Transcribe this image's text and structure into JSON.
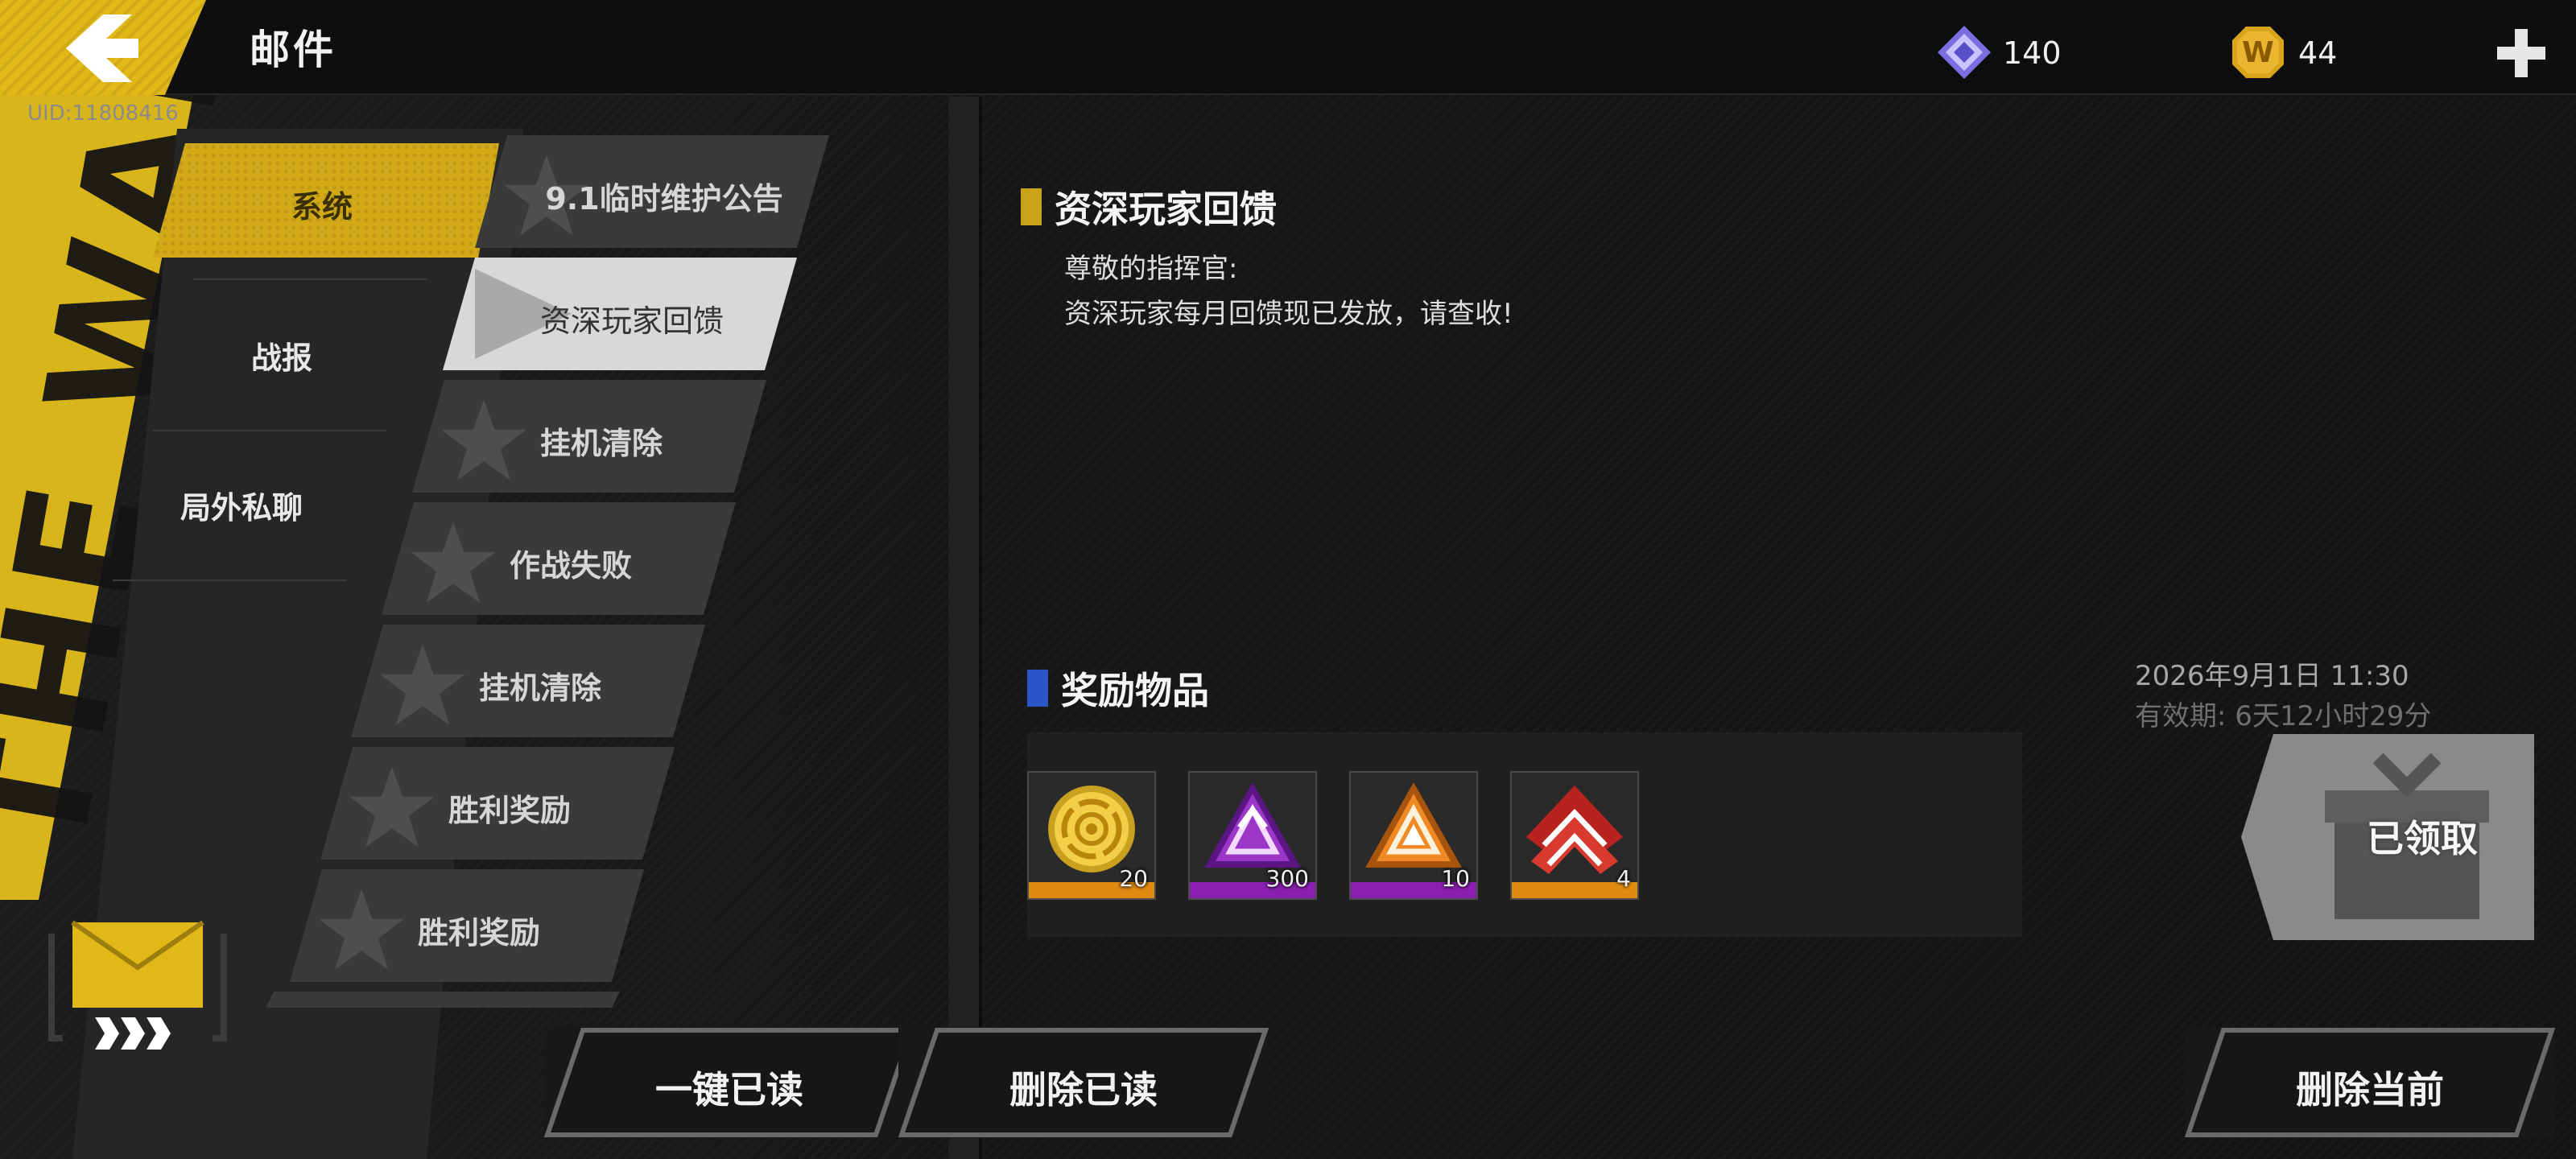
{
  "header": {
    "title": "邮件",
    "uid": "UID:11808416",
    "currencies": [
      {
        "name": "diamond",
        "amount": "140",
        "icon": "diamond-icon"
      },
      {
        "name": "coin",
        "amount": "44",
        "icon": "coin-icon",
        "symbol": "W"
      }
    ]
  },
  "decor": {
    "stripe_text": "THE WAR",
    "colors": {
      "accent_yellow": "#d2aa18",
      "reward_blue": "#2c56c8"
    }
  },
  "categories": [
    {
      "label": "系统",
      "selected": true
    },
    {
      "label": "战报",
      "selected": false
    },
    {
      "label": "局外私聊",
      "selected": false
    }
  ],
  "mails": [
    {
      "label": "9.1临时维护公告",
      "selected": false
    },
    {
      "label": "资深玩家回馈",
      "selected": true
    },
    {
      "label": "挂机清除",
      "selected": false
    },
    {
      "label": "作战失败",
      "selected": false
    },
    {
      "label": "挂机清除",
      "selected": false
    },
    {
      "label": "胜利奖励",
      "selected": false
    },
    {
      "label": "胜利奖励",
      "selected": false
    }
  ],
  "content": {
    "title": "资深玩家回馈",
    "greeting": "尊敬的指挥官:",
    "body": "资深玩家每月回馈现已发放，请查收!",
    "reward_title": "奖励物品",
    "rewards": [
      {
        "icon": "gold-target-icon",
        "quantity": "20",
        "rarity_color": "#e08a12"
      },
      {
        "icon": "purple-triangle-icon",
        "quantity": "300",
        "rarity_color": "#8a1fb0"
      },
      {
        "icon": "orange-triangle-icon",
        "quantity": "10",
        "rarity_color": "#8a1fb0"
      },
      {
        "icon": "red-chevron-icon",
        "quantity": "4",
        "rarity_color": "#e08a12"
      }
    ],
    "date": "2026年9月1日  11:30",
    "expiry": "有效期:  6天12小时29分",
    "claim_label": "已领取"
  },
  "actions": {
    "read_all": "一键已读",
    "delete_read": "删除已读",
    "delete_current": "删除当前"
  }
}
